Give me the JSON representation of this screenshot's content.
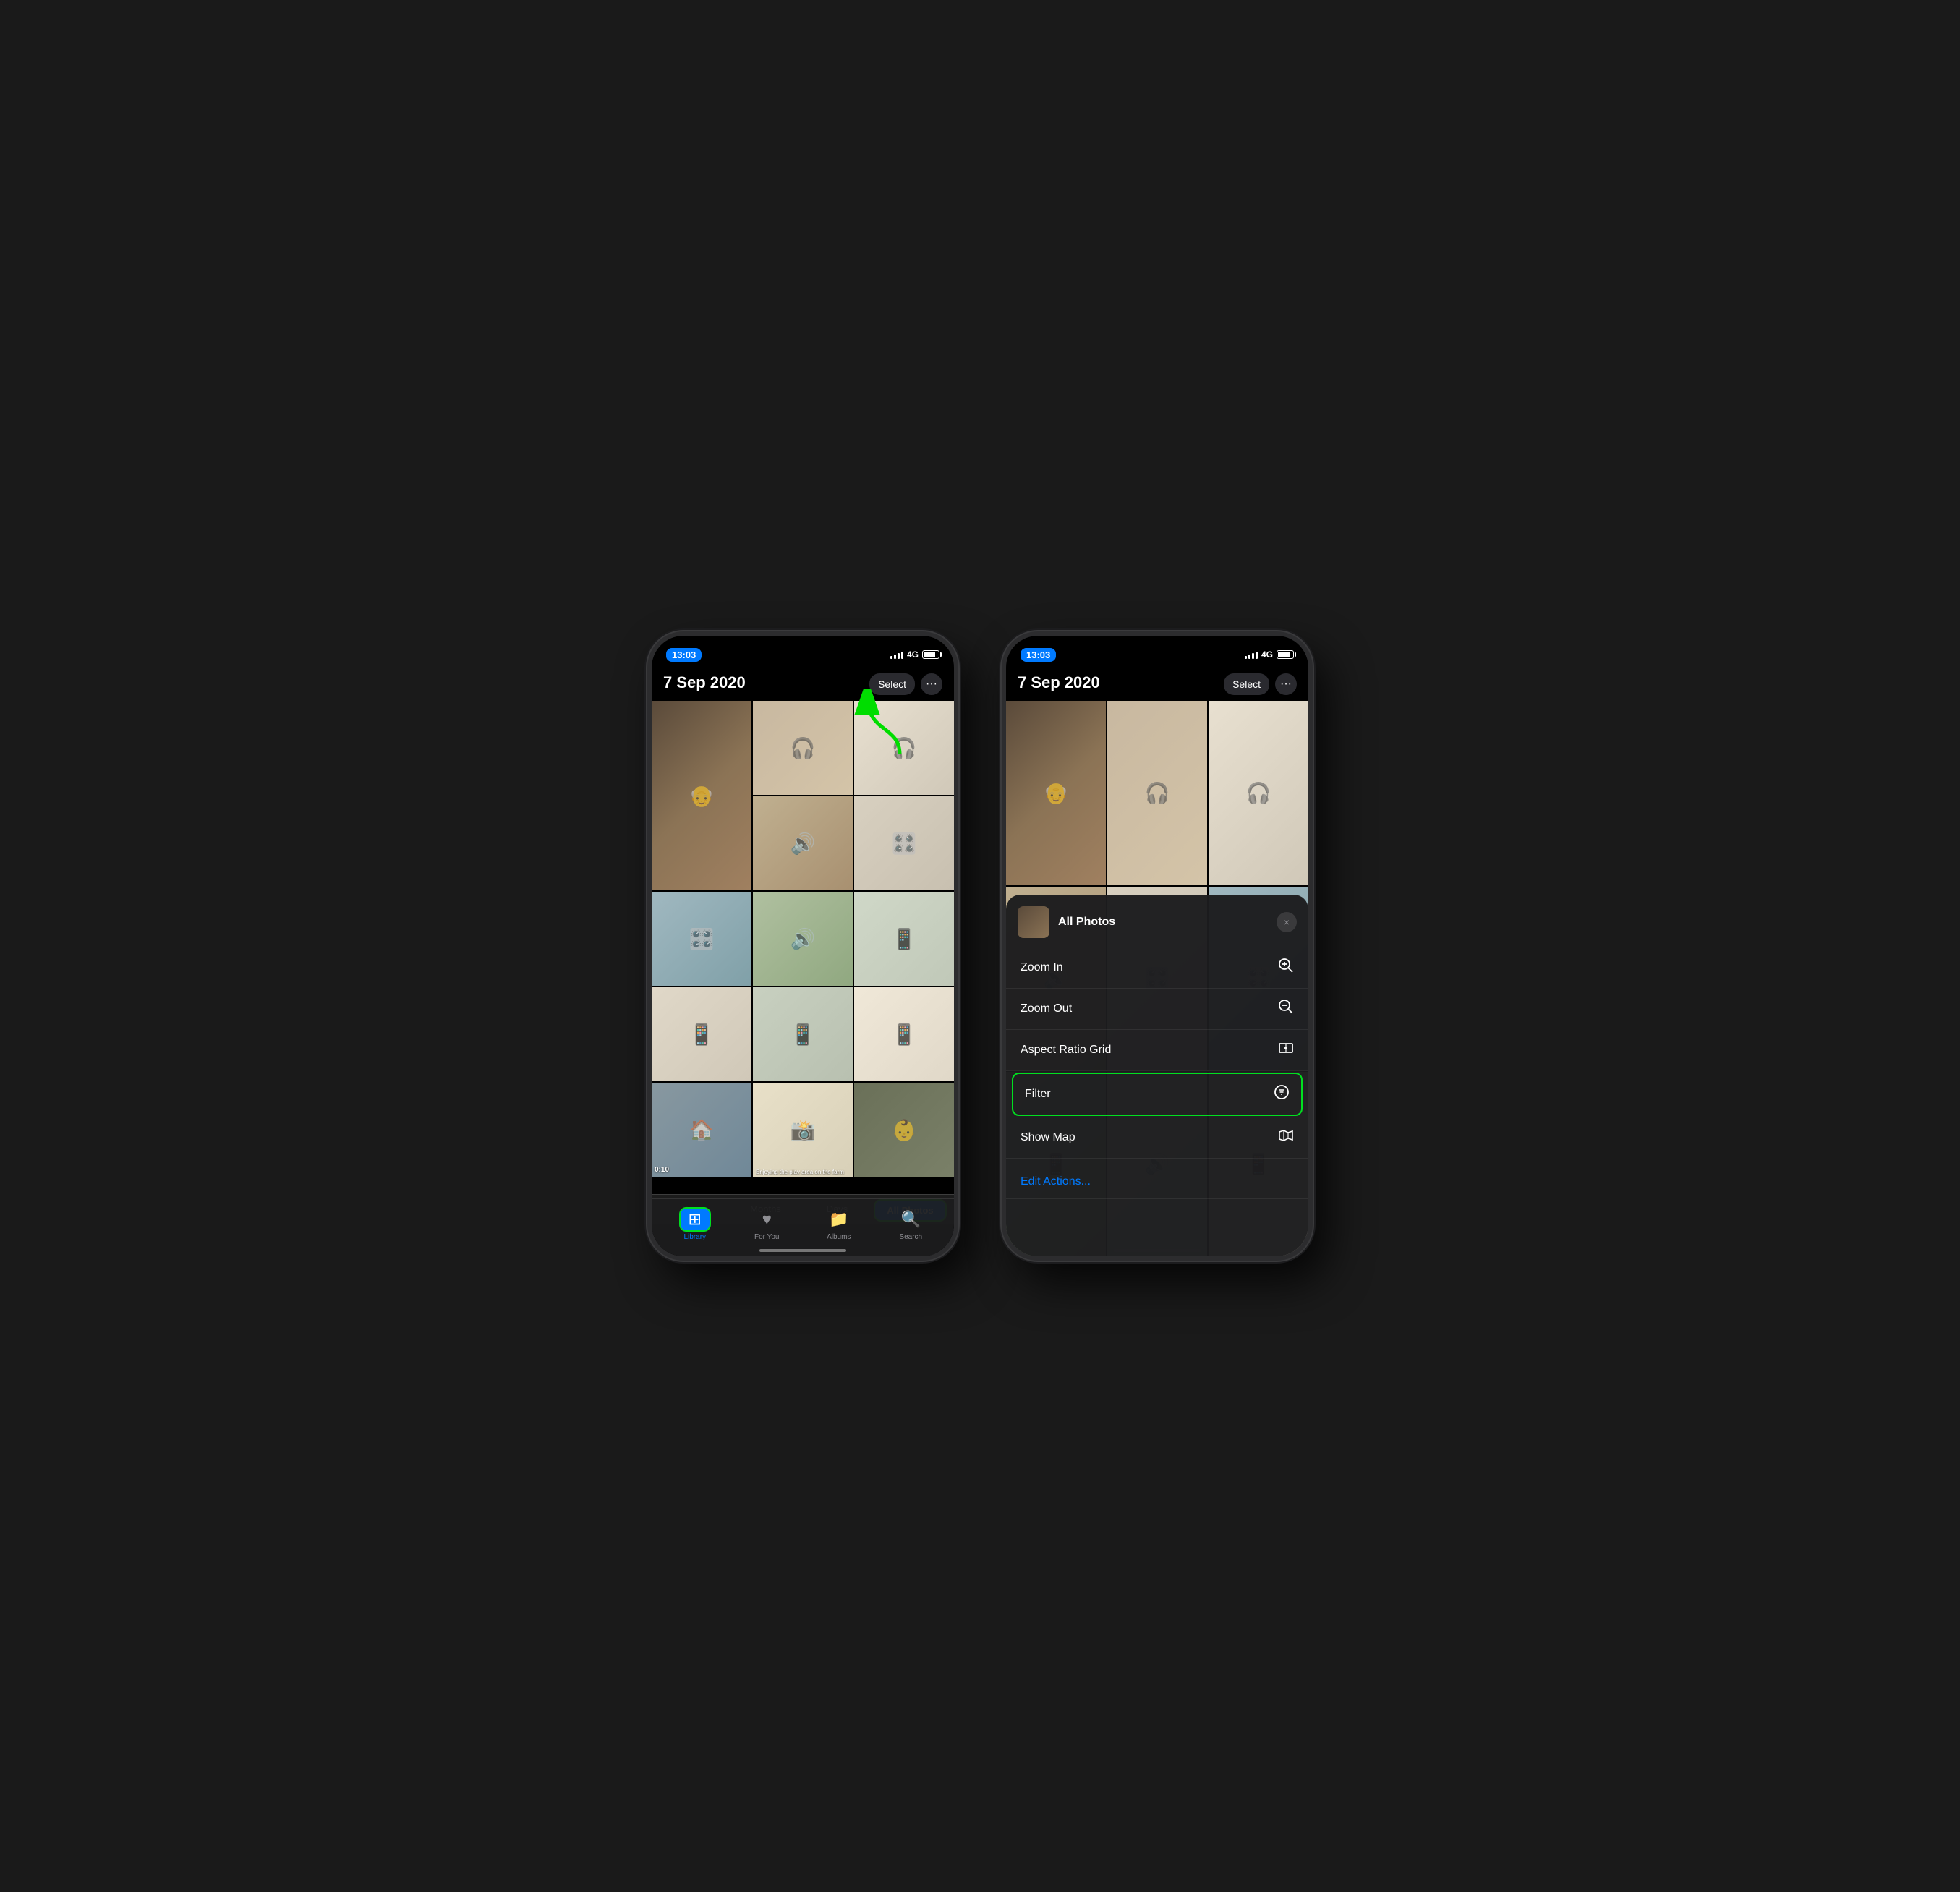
{
  "phones": [
    {
      "id": "left",
      "status": {
        "time": "13:03",
        "signal": "4G",
        "battery": 80
      },
      "header": {
        "date": "7 Sep 2020",
        "select_label": "Select",
        "more_label": "···"
      },
      "grid": {
        "cells": [
          {
            "id": 1,
            "class": "cell-1",
            "icon": "👴"
          },
          {
            "id": 2,
            "class": "cell-2",
            "icon": "🎧"
          },
          {
            "id": 3,
            "class": "cell-3",
            "icon": "🎧"
          },
          {
            "id": 4,
            "class": "cell-4",
            "icon": "🔊"
          },
          {
            "id": 5,
            "class": "cell-5",
            "icon": "🎛️"
          },
          {
            "id": 6,
            "class": "cell-6",
            "icon": "🎛️"
          },
          {
            "id": 7,
            "class": "cell-7",
            "icon": "📱"
          },
          {
            "id": 8,
            "class": "cell-8",
            "icon": "📱"
          },
          {
            "id": 9,
            "class": "cell-9",
            "icon": "📱"
          },
          {
            "id": 10,
            "class": "cell-10",
            "icon": "📱"
          },
          {
            "id": 11,
            "class": "cell-11",
            "icon": "🔊"
          },
          {
            "id": 12,
            "class": "cell-12",
            "icon": "🏠"
          },
          {
            "id": 13,
            "class": "cell-13",
            "icon": "📸"
          },
          {
            "id": 14,
            "class": "cell-14",
            "icon": "👶"
          },
          {
            "id": 15,
            "class": "cell-15",
            "icon": "👶"
          }
        ]
      },
      "view_tabs": [
        "Years",
        "Months",
        "Days",
        "All Photos"
      ],
      "active_tab": "All Photos",
      "nav": [
        {
          "id": "library",
          "label": "Library",
          "icon": "🖼️",
          "active": true
        },
        {
          "id": "for-you",
          "label": "For You",
          "icon": "❤️",
          "active": false
        },
        {
          "id": "albums",
          "label": "Albums",
          "icon": "📁",
          "active": false
        },
        {
          "id": "search",
          "label": "Search",
          "icon": "🔍",
          "active": false
        }
      ],
      "duration": "0:10",
      "caption": "Enjoying the play area on the farm"
    }
  ],
  "right_phone": {
    "status": {
      "time": "13:03",
      "signal": "4G"
    },
    "header": {
      "date": "7 Sep 2020",
      "select_label": "Select",
      "more_label": "···"
    },
    "context_menu": {
      "title": "All Photos",
      "close_label": "×",
      "items": [
        {
          "id": "zoom-in",
          "label": "Zoom In",
          "icon": "⊕"
        },
        {
          "id": "zoom-out",
          "label": "Zoom Out",
          "icon": "⊖"
        },
        {
          "id": "aspect-ratio",
          "label": "Aspect Ratio Grid",
          "icon": "▣"
        },
        {
          "id": "filter",
          "label": "Filter",
          "icon": "⊜",
          "highlighted": true
        },
        {
          "id": "show-map",
          "label": "Show Map",
          "icon": "🗺"
        },
        {
          "id": "edit-actions",
          "label": "Edit Actions...",
          "style": "blue"
        }
      ]
    }
  },
  "arrow": {
    "color": "#00dd00"
  }
}
